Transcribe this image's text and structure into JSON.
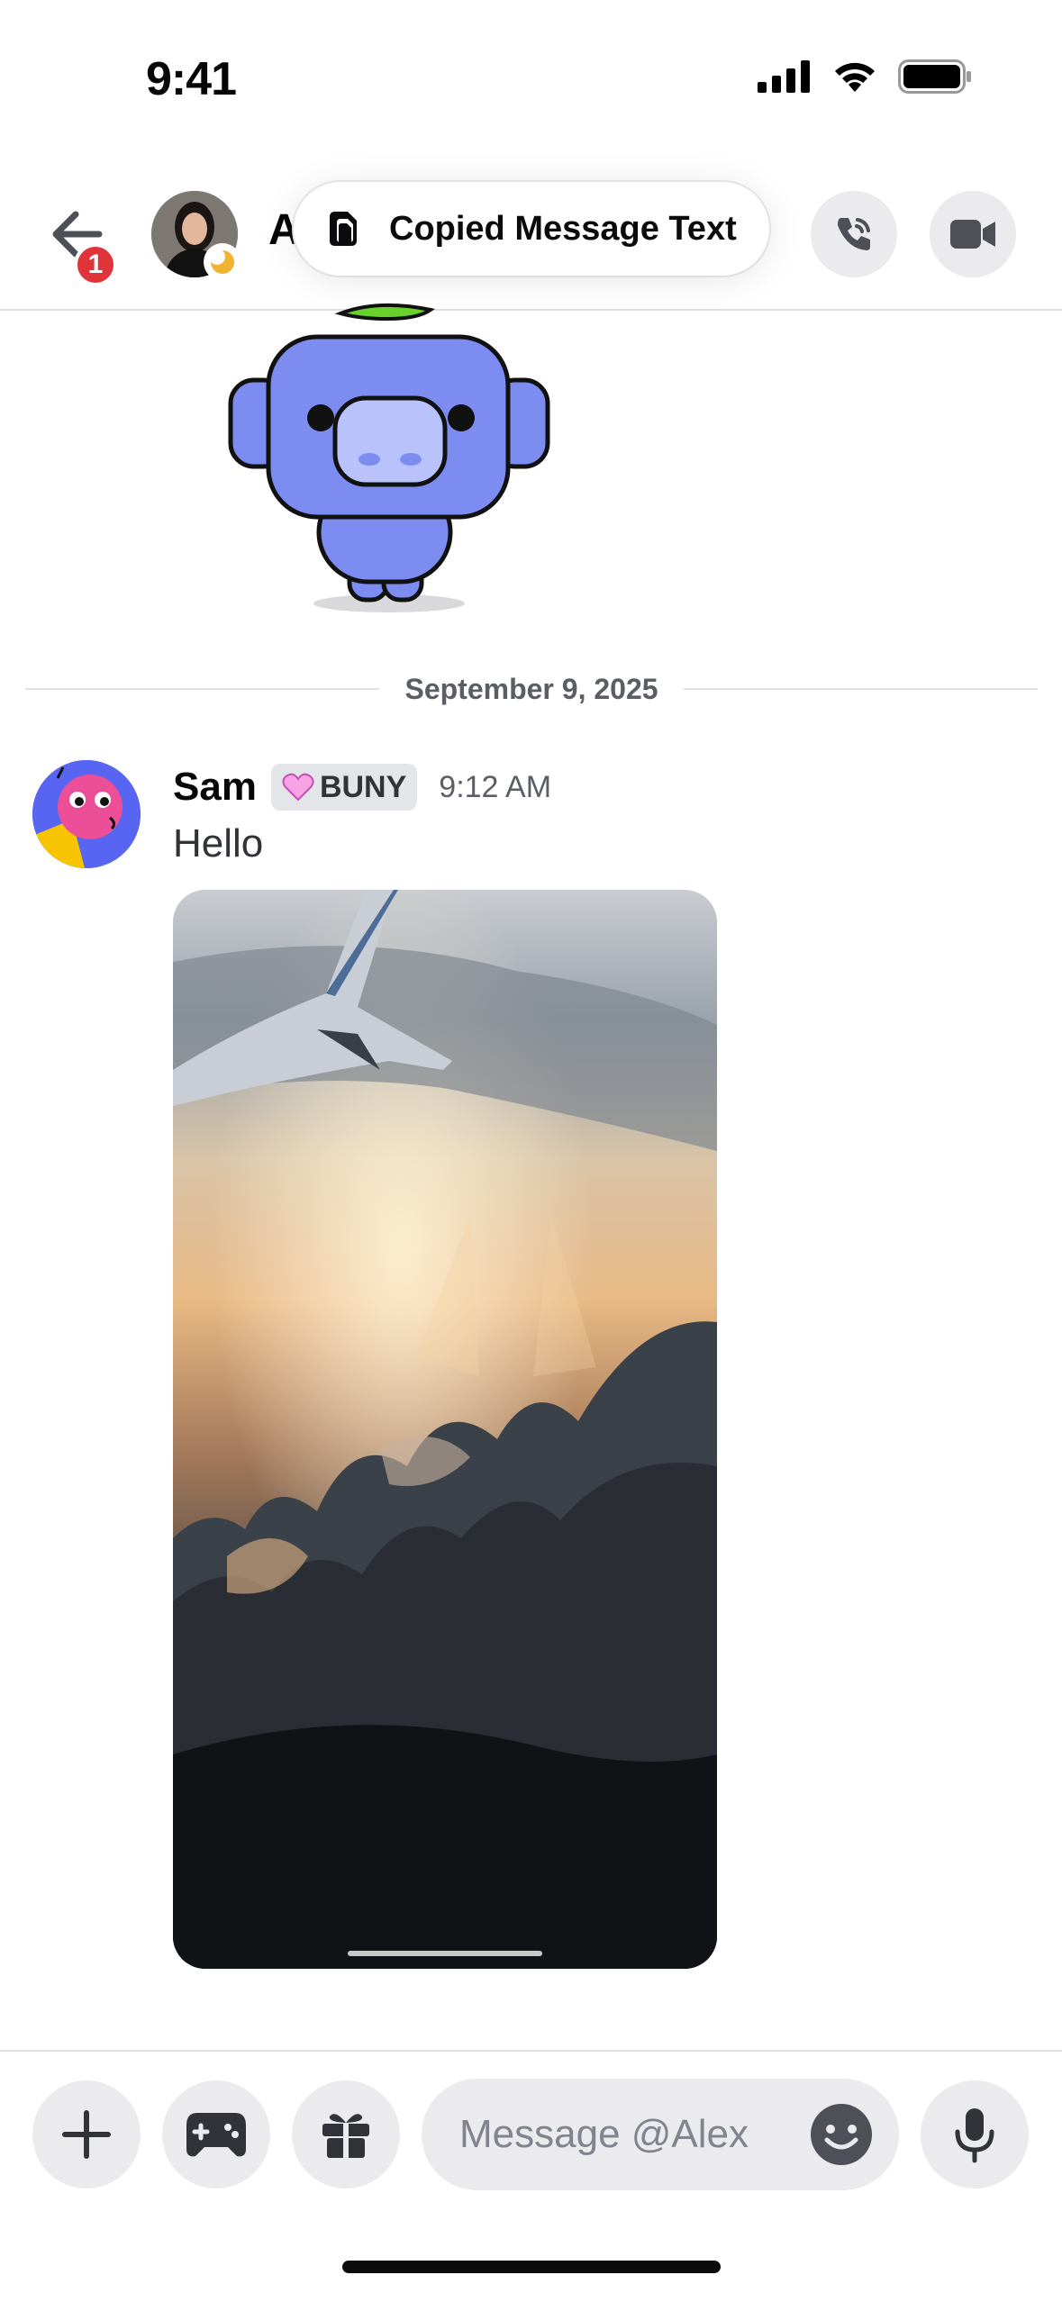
{
  "status_bar": {
    "time": "9:41",
    "signal_icon": "cellular-signal-icon",
    "wifi_icon": "wifi-icon",
    "battery_icon": "battery-full-icon"
  },
  "header": {
    "back_badge": "1",
    "name": "A",
    "toast_text": "Copied Message Text",
    "toast_icon": "copy-icon",
    "call_icon": "phone-icon",
    "video_icon": "video-camera-icon"
  },
  "divider": {
    "date": "September 9, 2025"
  },
  "message": {
    "author": "Sam",
    "tag": "BUNY",
    "time": "9:12 AM",
    "text": "Hello"
  },
  "composer": {
    "placeholder": "Message @Alex",
    "plus_icon": "plus-icon",
    "game_icon": "gamepad-icon",
    "gift_icon": "gift-icon",
    "emoji_icon": "emoji-icon",
    "mic_icon": "microphone-icon"
  },
  "colors": {
    "badge_red": "#e0343b",
    "button_gray": "#ebebed",
    "brand_blurple": "#5865f2",
    "idle_status": "#f0b232"
  }
}
